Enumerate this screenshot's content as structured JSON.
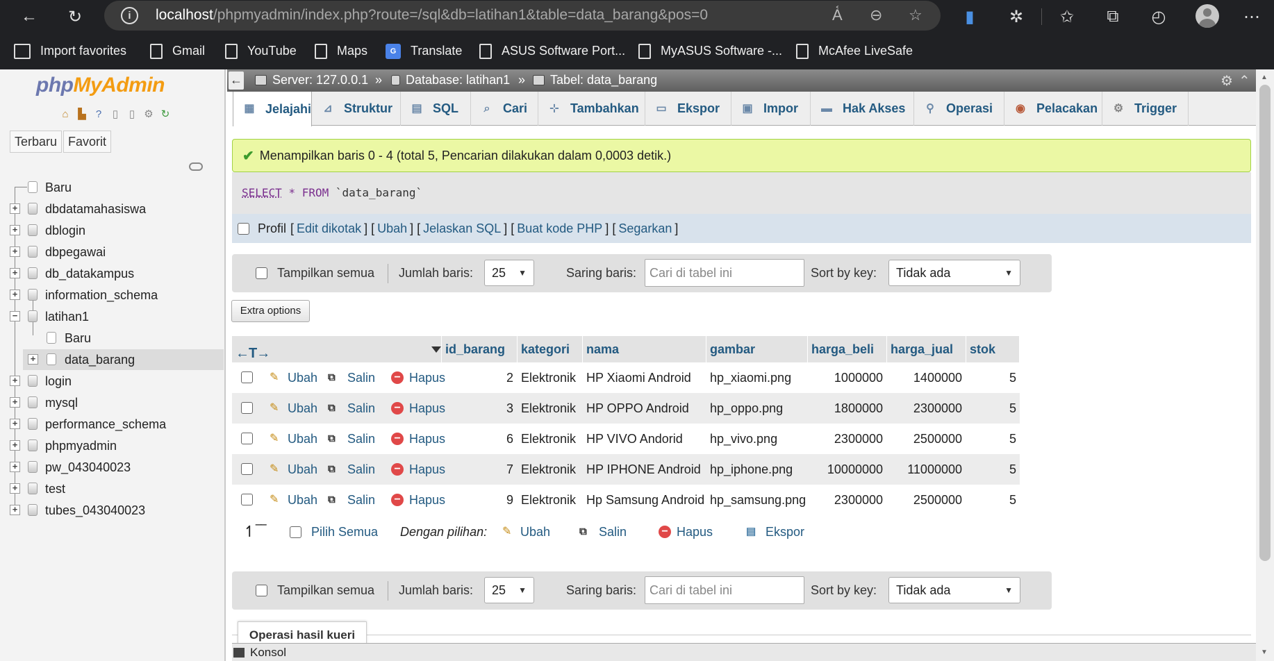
{
  "browser": {
    "url_host": "localhost",
    "url_path": "/phpmyadmin/index.php?route=/sql&db=latihan1&table=data_barang&pos=0",
    "favorites": [
      {
        "label": "Import favorites",
        "icon": "import-icon"
      },
      {
        "label": "Gmail",
        "icon": "page-icon"
      },
      {
        "label": "YouTube",
        "icon": "page-icon"
      },
      {
        "label": "Maps",
        "icon": "page-icon"
      },
      {
        "label": "Translate",
        "icon": "translate-icon"
      },
      {
        "label": "ASUS Software Port...",
        "icon": "page-icon"
      },
      {
        "label": "MyASUS Software -...",
        "icon": "page-icon"
      },
      {
        "label": "McAfee LiveSafe",
        "icon": "page-icon"
      }
    ],
    "translate_badge": "G"
  },
  "sidebar": {
    "logo_php": "php",
    "logo_my": "MyAdmin",
    "tabs": [
      "Terbaru",
      "Favorit"
    ],
    "tree": [
      {
        "label": "Baru",
        "type": "new"
      },
      {
        "label": "dbdatamahasiswa",
        "type": "db"
      },
      {
        "label": "dblogin",
        "type": "db"
      },
      {
        "label": "dbpegawai",
        "type": "db"
      },
      {
        "label": "db_datakampus",
        "type": "db"
      },
      {
        "label": "information_schema",
        "type": "db"
      },
      {
        "label": "latihan1",
        "type": "db-open"
      },
      {
        "label": "Baru",
        "type": "child-new"
      },
      {
        "label": "data_barang",
        "type": "child-table"
      },
      {
        "label": "login",
        "type": "db"
      },
      {
        "label": "mysql",
        "type": "db"
      },
      {
        "label": "performance_schema",
        "type": "db"
      },
      {
        "label": "phpmyadmin",
        "type": "db"
      },
      {
        "label": "pw_043040023",
        "type": "db"
      },
      {
        "label": "test",
        "type": "db"
      },
      {
        "label": "tubes_043040023",
        "type": "db"
      }
    ]
  },
  "breadcrumb": {
    "server": "Server: 127.0.0.1",
    "database": "Database: latihan1",
    "table": "Tabel: data_barang",
    "sep": "»"
  },
  "tabs": [
    {
      "label": "Jelajahi",
      "icon": "browse-icon",
      "glyph": "▦"
    },
    {
      "label": "Struktur",
      "icon": "structure-icon",
      "glyph": "⊿"
    },
    {
      "label": "SQL",
      "icon": "sql-icon",
      "glyph": "▤"
    },
    {
      "label": "Cari",
      "icon": "search-icon",
      "glyph": "⌕"
    },
    {
      "label": "Tambahkan",
      "icon": "insert-icon",
      "glyph": "⊹"
    },
    {
      "label": "Ekspor",
      "icon": "export-icon",
      "glyph": "▭"
    },
    {
      "label": "Impor",
      "icon": "import-icon",
      "glyph": "▣"
    },
    {
      "label": "Hak Akses",
      "icon": "privileges-icon",
      "glyph": "▬"
    },
    {
      "label": "Operasi",
      "icon": "wrench-icon",
      "glyph": "⚲"
    },
    {
      "label": "Pelacakan",
      "icon": "eye-icon",
      "glyph": "◉"
    },
    {
      "label": "Trigger",
      "icon": "trigger-icon",
      "glyph": "⚙"
    }
  ],
  "message": "Menampilkan baris 0 - 4 (total 5, Pencarian dilakukan dalam 0,0003 detik.)",
  "query": {
    "select": "SELECT",
    "star": "*",
    "from": "FROM",
    "table": "`data_barang`"
  },
  "profil": {
    "label": "Profil",
    "links": [
      "Edit dikotak",
      "Ubah",
      "Jelaskan SQL",
      "Buat kode PHP",
      "Segarkan"
    ]
  },
  "navbar": {
    "show_all": "Tampilkan semua",
    "rows_label": "Jumlah baris:",
    "rows_value": "25",
    "filter_label": "Saring baris:",
    "filter_placeholder": "Cari di tabel ini",
    "sort_label": "Sort by key:",
    "sort_value": "Tidak ada"
  },
  "extra_options": "Extra options",
  "table": {
    "sort_arrows": "←T→",
    "columns": [
      "id_barang",
      "kategori",
      "nama",
      "gambar",
      "harga_beli",
      "harga_jual",
      "stok"
    ],
    "actions": {
      "edit": "Ubah",
      "copy": "Salin",
      "delete": "Hapus"
    },
    "rows": [
      [
        "2",
        "Elektronik",
        "HP Xiaomi Android",
        "hp_xiaomi.png",
        "1000000",
        "1400000",
        "5"
      ],
      [
        "3",
        "Elektronik",
        "HP OPPO Android",
        "hp_oppo.png",
        "1800000",
        "2300000",
        "5"
      ],
      [
        "6",
        "Elektronik",
        "HP VIVO Andorid",
        "hp_vivo.png",
        "2300000",
        "2500000",
        "5"
      ],
      [
        "7",
        "Elektronik",
        "HP IPHONE Android",
        "hp_iphone.png",
        "10000000",
        "11000000",
        "5"
      ],
      [
        "9",
        "Elektronik",
        "Hp Samsung Android",
        "hp_samsung.png",
        "2300000",
        "2500000",
        "5"
      ]
    ]
  },
  "bulk": {
    "select_all": "Pilih Semua",
    "with_selected": "Dengan pilihan:",
    "edit": "Ubah",
    "copy": "Salin",
    "delete": "Hapus",
    "export": "Ekspor"
  },
  "ops_tab": "Operasi hasil kueri",
  "console": "Konsol"
}
